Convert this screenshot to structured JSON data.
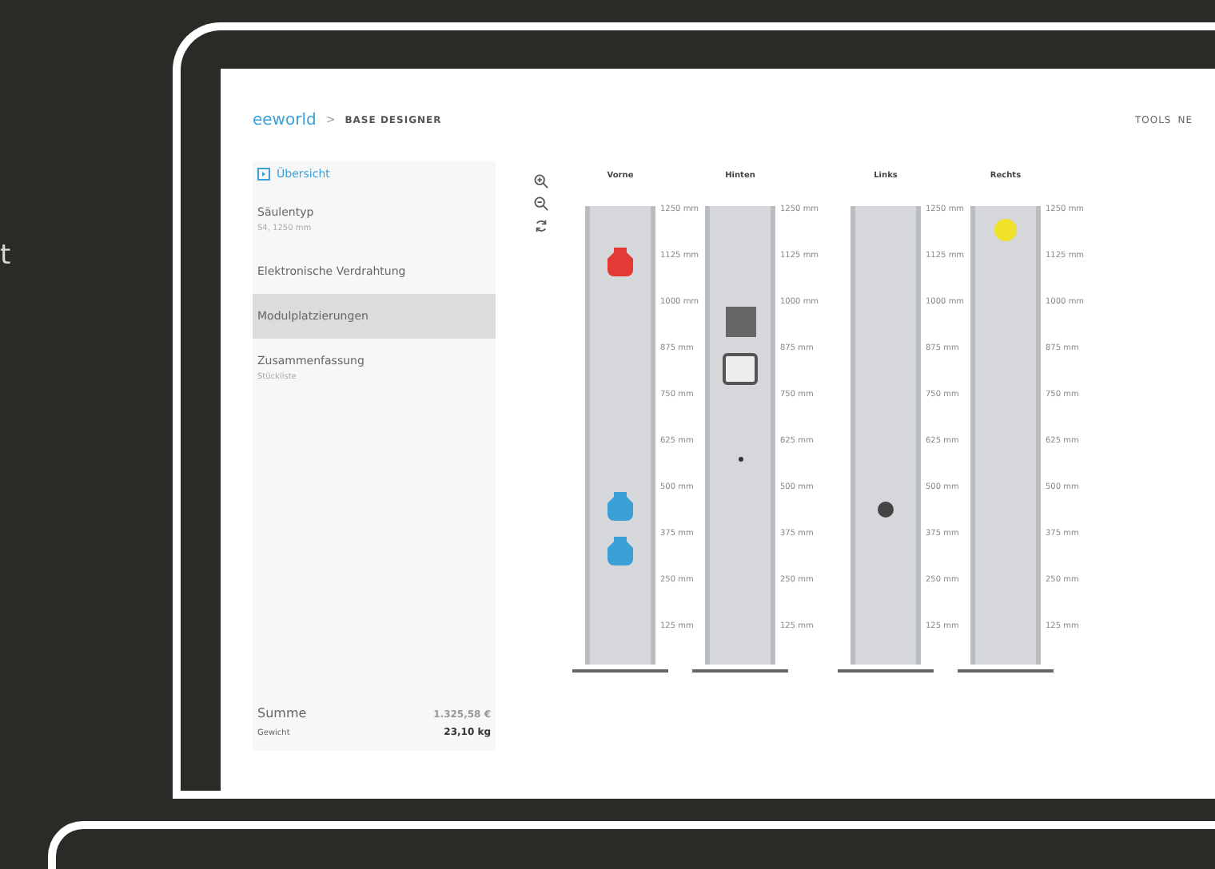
{
  "backdrop_text": "t",
  "header": {
    "logo": "eeworld",
    "separator": ">",
    "title": "BASE DESIGNER",
    "nav": [
      "TOOLS",
      "NE"
    ]
  },
  "sidebar": {
    "items": [
      {
        "label": "Übersicht",
        "kind": "link",
        "selected": false
      },
      {
        "label": "Säulentyp",
        "sub": "S4, 1250 mm",
        "kind": "step",
        "selected": false
      },
      {
        "label": "Elektronische Verdrahtung",
        "kind": "step",
        "selected": false
      },
      {
        "label": "Modulplatzierungen",
        "kind": "step",
        "selected": true
      },
      {
        "label": "Zusammenfassung",
        "sub": "Stückliste",
        "kind": "step",
        "selected": false
      }
    ],
    "totals": [
      {
        "label": "Summe",
        "value": "1.325,58 €",
        "kind": "main"
      },
      {
        "label": "Gewicht",
        "value": "23,10 kg",
        "kind": "minor"
      }
    ]
  },
  "columns": [
    {
      "title": "Vorne",
      "scale": [
        "1250 mm",
        "1125 mm",
        "1000 mm",
        "875 mm",
        "750 mm",
        "625 mm",
        "500 mm",
        "375 mm",
        "250 mm",
        "125 mm"
      ]
    },
    {
      "title": "Hinten",
      "scale": [
        "1250 mm",
        "1125 mm",
        "1000 mm",
        "875 mm",
        "750 mm",
        "625 mm",
        "500 mm",
        "375 mm",
        "250 mm",
        "125 mm"
      ]
    },
    {
      "title": "Links",
      "scale": [
        "1250 mm",
        "1125 mm",
        "1000 mm",
        "875 mm",
        "750 mm",
        "625 mm",
        "500 mm",
        "375 mm",
        "250 mm",
        "125 mm"
      ]
    },
    {
      "title": "Rechts",
      "scale": [
        "1250 mm",
        "1125 mm",
        "1000 mm",
        "875 mm",
        "750 mm",
        "625 mm",
        "500 mm",
        "375 mm",
        "250 mm",
        "125 mm"
      ]
    }
  ]
}
